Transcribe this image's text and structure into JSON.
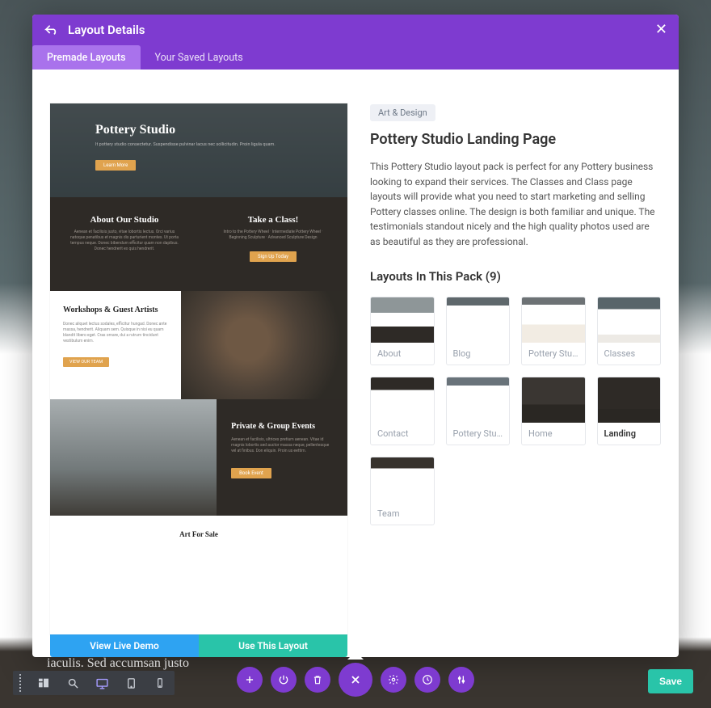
{
  "header": {
    "title": "Layout Details",
    "tabs": [
      {
        "label": "Premade Layouts",
        "active": true
      },
      {
        "label": "Your Saved Layouts",
        "active": false
      }
    ]
  },
  "preview": {
    "hero_title": "Pottery Studio",
    "hero_sub": "It pottery studio consectetur. Suspendisse pulvinar lacus nec sollicitudin. Proin ligula quam.",
    "hero_btn": "Learn More",
    "about_title": "About Our Studio",
    "about_text": "Aenean et facilisis justo, vitae lobortis lectus. Orci varius natoque penatibus et magnis dis parturient montes. Ut porta tempus neque. Donec bibendum efficitur quam non dapibus. Donec hendrerit ex quis hendrerit.",
    "class_title": "Take a Class!",
    "class_text": "Intro to the Pottery Wheel · Intermediate Pottery Wheel · Beginning Sculpture · Advanced Sculpture Design",
    "class_btn": "Sign Up Today",
    "workshop_title": "Workshops & Guest Artists",
    "workshop_text": "Donec aliquet lectus sodales, efficitur hungad. Donec ante massa, hendrerit. Aliquam sem. Quisque in nisi eu quam blandit libero eget. Cras ornare, dui a rutrum tincidunt vestibulum enim.",
    "workshop_btn": "VIEW OUR TEAM",
    "events_title": "Private & Group Events",
    "events_text": "Aenean et facilisis, ultrices pretium aenean. Vitae id magnis lobortis sed auctor massa neque, pellentesque vel at finibus. Don eliquin. Proin us eettim.",
    "events_btn": "Book Event",
    "art_title": "Art For Sale",
    "view_demo": "View Live Demo",
    "use_layout": "Use This Layout"
  },
  "detail": {
    "category": "Art & Design",
    "title": "Pottery Studio Landing Page",
    "description": "This Pottery Studio layout pack is perfect for any Pottery business looking to expand their services. The Classes and Class page layouts will provide what you need to start marketing and selling Pottery classes online. The design is both familiar and unique. The testimonials standout nicely and the high quality photos used are as beautiful as they are professional.",
    "pack_heading": "Layouts In This Pack (9)",
    "layouts": [
      {
        "label": "About"
      },
      {
        "label": "Blog"
      },
      {
        "label": "Pottery Studi..."
      },
      {
        "label": "Classes"
      },
      {
        "label": "Contact"
      },
      {
        "label": "Pottery Studi..."
      },
      {
        "label": "Home"
      },
      {
        "label": "Landing",
        "active": true
      },
      {
        "label": "Team"
      }
    ]
  },
  "bg": {
    "line": "iaculis. Sed accumsan justo"
  },
  "bottom": {
    "save": "Save"
  }
}
